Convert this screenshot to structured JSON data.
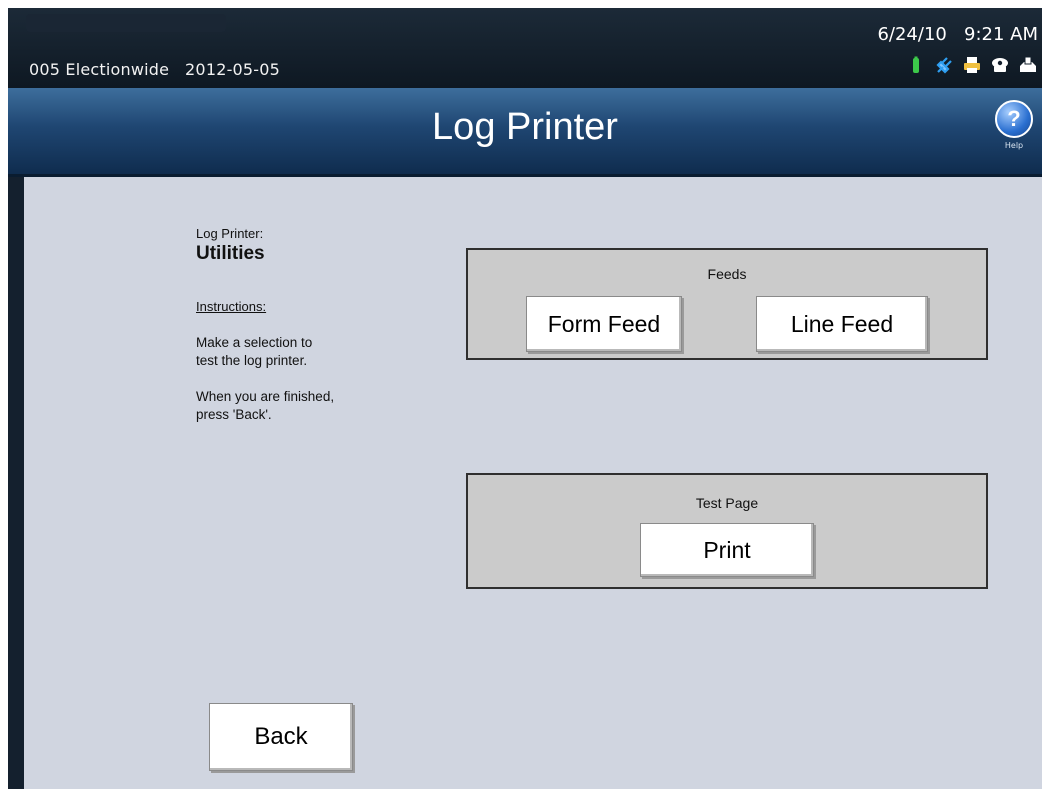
{
  "status": {
    "election_info": "005 Electionwide   2012-05-05",
    "datetime": "6/24/10   9:21 AM",
    "icons": [
      "battery-icon",
      "power-plug-icon",
      "printer-icon",
      "network-icon",
      "card-reader-icon"
    ]
  },
  "header": {
    "title": "Log Printer",
    "help_symbol": "?",
    "help_label": "Help"
  },
  "left": {
    "section_label": "Log Printer:",
    "section_title": "Utilities",
    "instructions_label": "Instructions:",
    "instruction_1": "Make a selection to\ntest the log printer.",
    "instruction_2": "When you are finished,\npress 'Back'."
  },
  "feeds": {
    "title": "Feeds",
    "form_feed_label": "Form Feed",
    "line_feed_label": "Line Feed"
  },
  "test_page": {
    "title": "Test Page",
    "print_label": "Print"
  },
  "footer": {
    "back_label": "Back"
  },
  "colors": {
    "status_bar": "#14202e",
    "header_top": "#3d6e9c",
    "header_bottom": "#0f2c4e",
    "content_bg": "#d0d5e0",
    "group_bg": "#cbcbcb",
    "battery": "#3cc84a",
    "plug": "#2e9ef0",
    "printer": "#f0c040"
  }
}
